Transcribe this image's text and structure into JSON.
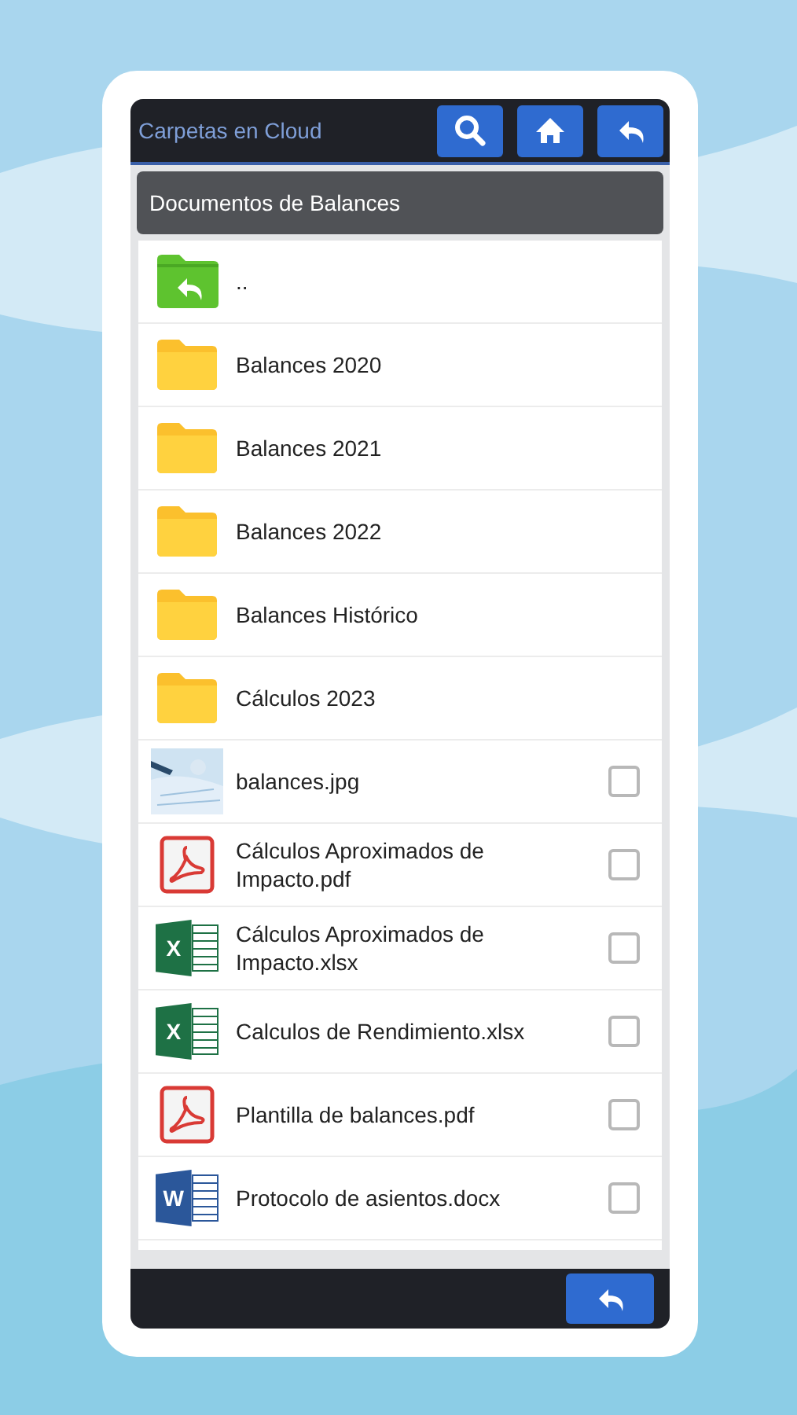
{
  "top_bar": {
    "title": "Carpetas en Cloud",
    "buttons": [
      {
        "kind": "search"
      },
      {
        "kind": "home"
      },
      {
        "kind": "back"
      }
    ]
  },
  "folder_header": {
    "title": "Documentos de Balances"
  },
  "items": [
    {
      "kind": "parent",
      "name": ".."
    },
    {
      "kind": "folder",
      "name": "Balances 2020"
    },
    {
      "kind": "folder",
      "name": "Balances 2021"
    },
    {
      "kind": "folder",
      "name": "Balances 2022"
    },
    {
      "kind": "folder",
      "name": "Balances Histórico"
    },
    {
      "kind": "folder",
      "name": "Cálculos 2023"
    },
    {
      "name": "balances.jpg",
      "checked": false
    },
    {
      "kind": "pdf",
      "name": "Cálculos Aproximados de Impacto.pdf",
      "checked": false
    },
    {
      "kind": "xlsx",
      "name": "Cálculos Aproximados de Impacto.xlsx",
      "icon_text": "X",
      "checked": false
    },
    {
      "kind": "xlsx",
      "name": "Calculos de Rendimiento.xlsx",
      "icon_text": "X",
      "checked": false
    },
    {
      "kind": "pdf",
      "name": "Plantilla de balances.pdf",
      "checked": false
    },
    {
      "kind": "docx",
      "name": "Protocolo de asientos.docx",
      "icon_text": "W",
      "checked": false
    }
  ],
  "bottom_bar": {
    "buttons": [
      {
        "kind": "back"
      }
    ]
  }
}
